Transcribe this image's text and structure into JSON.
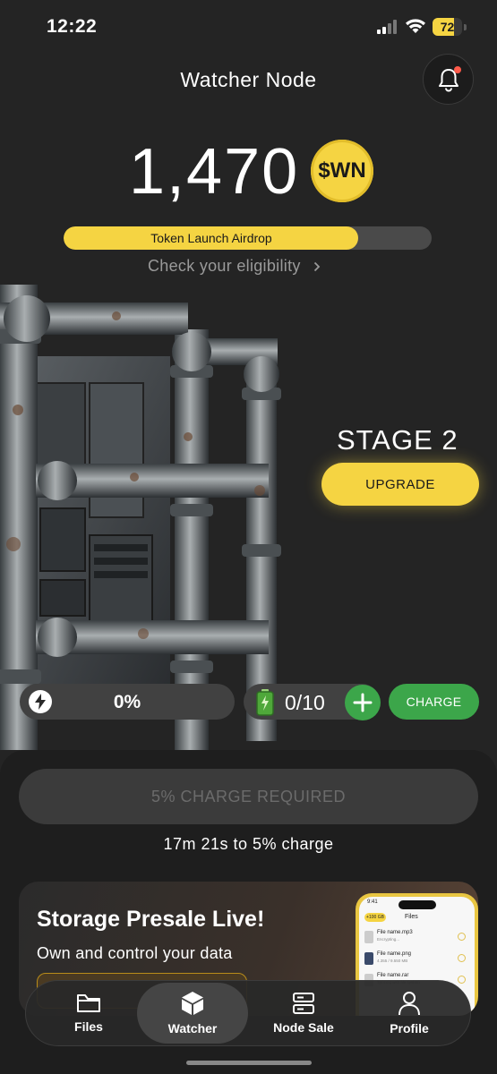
{
  "status_bar": {
    "time": "12:22",
    "battery_level": "72",
    "battery_fraction": 0.72
  },
  "header": {
    "title": "Watcher Node",
    "notification_icon": "bell-icon",
    "has_unread": true
  },
  "balance": {
    "amount": "1,470",
    "token_symbol": "$WN"
  },
  "airdrop": {
    "label": "Token Launch Airdrop",
    "progress": 0.8,
    "eligibility_link": "Check your eligibility"
  },
  "node": {
    "stage_label": "STAGE 2",
    "upgrade_label": "UPGRADE"
  },
  "energy": {
    "icon": "lightning-icon",
    "value": "0%"
  },
  "charges": {
    "icon": "battery-charge-icon",
    "value": "0/10",
    "add_icon": "plus-icon",
    "charge_label": "CHARGE"
  },
  "sheet": {
    "required_label": "5% CHARGE REQUIRED",
    "countdown": "17m 21s to 5% charge"
  },
  "promo": {
    "title": "Storage Presale Live!",
    "subtitle": "Own and control your data",
    "phone": {
      "time": "9:41",
      "chip": "+100 GB",
      "title": "Files",
      "rows": [
        {
          "name": "File name.mp3",
          "meta": "Encrypting..."
        },
        {
          "name": "File name.png",
          "meta": "4.355 / 9.550 MB"
        },
        {
          "name": "File name.rar",
          "meta": "Syncing with file system"
        }
      ]
    }
  },
  "tab_bar": {
    "tabs": [
      {
        "label": "Files",
        "icon": "folder-icon",
        "active": false
      },
      {
        "label": "Watcher",
        "icon": "cube-icon",
        "active": true
      },
      {
        "label": "Node Sale",
        "icon": "server-icon",
        "active": false
      },
      {
        "label": "Profile",
        "icon": "person-icon",
        "active": false
      }
    ]
  },
  "colors": {
    "accent_yellow": "#f5d442",
    "action_green": "#3ca64a",
    "background": "#242424",
    "notification_dot": "#ff5a4a"
  }
}
